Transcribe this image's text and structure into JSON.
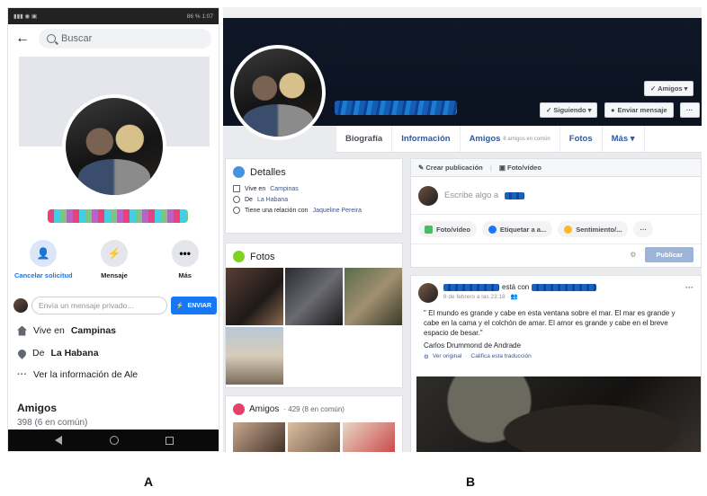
{
  "captions": {
    "a": "A",
    "b": "B"
  },
  "mobile": {
    "status_right": "86 % 1:07",
    "search_placeholder": "Buscar",
    "actions": [
      {
        "label": "Cancelar solicitud",
        "icon": "person-add-icon",
        "glyph": "👤"
      },
      {
        "label": "Mensaje",
        "icon": "messenger-icon",
        "glyph": "⚡"
      },
      {
        "label": "Más",
        "icon": "more-icon",
        "glyph": "•••"
      }
    ],
    "message_placeholder": "Envía un mensaje privado...",
    "send_label": "ENVIAR",
    "info": {
      "lives_prefix": "Vive en",
      "lives_city": "Campinas",
      "from_prefix": "De",
      "from_city": "La Habana",
      "see_more": "Ver la información de Ale"
    },
    "friends_title": "Amigos",
    "friends_count": "398 (6 en común)"
  },
  "desktop": {
    "btn_friends": "✓ Amigos ▾",
    "btn_following": "✓ Siguiendo ▾",
    "btn_message": "Enviar mensaje",
    "btn_more": "···",
    "tabs": {
      "bio": "Biografía",
      "info": "Información",
      "friends": "Amigos",
      "friends_sub": "8 amigos en común",
      "photos": "Fotos",
      "more": "Más ▾"
    },
    "details": {
      "title": "Detalles",
      "lives_prefix": "Vive en",
      "lives_city": "Campinas",
      "from_prefix": "De",
      "from_city": "La Habana",
      "relationship_prefix": "Tiene una relación con",
      "relationship_name": "Jaqueline Pereira"
    },
    "photos_title": "Fotos",
    "friends_title": "Amigos",
    "friends_count": "· 429 (8 en común)",
    "composer": {
      "create_post": "Crear publicación",
      "photo_video_head": "Foto/vídeo",
      "placeholder": "Escribe algo a",
      "chip_photo": "Foto/vídeo",
      "chip_tag": "Etiquetar a a...",
      "chip_feeling": "Sentimiento/...",
      "chip_more": "···",
      "publish": "Publicar"
    },
    "post": {
      "with_text": "está con",
      "date": "8 de febrero a las 23:18 ·",
      "text": "\" El mundo es grande y cabe en esta ventana sobre el mar. El mar es grande y cabe en la cama y el colchón de amar. El amor es grande y cabe en el breve espacio de besar.\"",
      "author": "Carlos Drummond de Andrade",
      "see_original": "Ver original",
      "rate_translation": "Califica esta traducción",
      "more": "···"
    }
  }
}
